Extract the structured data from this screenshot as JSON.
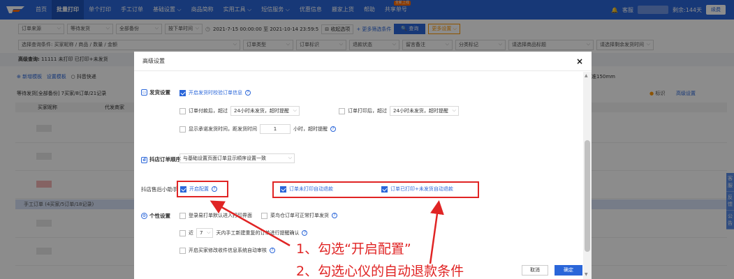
{
  "topbar": {
    "nav": [
      "首页",
      "批量打印",
      "单个打印",
      "手工订单",
      "基础设置 ⌵",
      "商品简称",
      "实用工具 ⌵",
      "短信服务 ⌵",
      "优惠信息",
      "搬家上货",
      "帮助",
      "共享单号"
    ],
    "active_index": 1,
    "badge": "全新上线",
    "service": "客服",
    "remaining": "剩余:144天",
    "renew": "续费"
  },
  "filters": {
    "row1": [
      "订单来源",
      "等待发货",
      "全部备份",
      "按下单时间"
    ],
    "date_range": "2021-7-15 00:00:00 至 2021-10-14 23:59:5",
    "collapse": "收起选项",
    "more_filters": "+ 更多筛选条件",
    "query": "查询",
    "more_settings": "更多设置",
    "row2": [
      "选择查询条件: 买家昵称 / 商品 / 数量 / 金额",
      "订单类型",
      "订单标识",
      "退款状态",
      "留言备注",
      "分类标记",
      "请选择商品标题",
      "请选择剩余发货时间"
    ],
    "quick_label": "高级查询:",
    "quick_items": "11111   未打印   已打印+未发货"
  },
  "background": {
    "new_template": "新增模板",
    "template_settings": "设置模板",
    "waybill": "抖音快递",
    "paper": "标准150mm",
    "status_line": "等待发货[全部备份]  7买家/8订单/21记录",
    "col_buyer": "买家昵称",
    "col_seller": "代发商家",
    "flag": "标识",
    "adv_settings": "高级设置",
    "group": "手工订单 (4买家/5订单/18记录)",
    "side_tabs": [
      "客服",
      "反馈",
      "公告"
    ]
  },
  "modal": {
    "title": "高级设置",
    "close": "×",
    "ship": {
      "label": "发货设置",
      "verify": "开启发货时校验订单信息",
      "pay_prefix": "订单付款后，超过",
      "pay_select": "24小时未发货，超时提醒",
      "print_prefix": "订单打印后，超过",
      "print_select": "24小时未发货，超时提醒",
      "promise_prefix": "显示承诺发货时间，距发货时间",
      "promise_value": "1",
      "promise_suffix": "小时，超时提醒"
    },
    "sort": {
      "label": "抖店订单顺序",
      "select": "与基础设置页面订单显示顺序设置一致"
    },
    "after_sale": {
      "label": "抖店售后小助手",
      "enable": "开启配置",
      "refund1": "订单未打印自动退款",
      "refund2": "订单已打印+未发货自动退款"
    },
    "personal": {
      "label": "个性设置",
      "opt1": "登录易打单默认进入打印界面",
      "opt2": "菜鸟仓订单可正常打单发货",
      "opt3_prefix": "近",
      "opt3_value": "7",
      "opt3_suffix": "天内手工新建重复的订单进行提醒确认",
      "opt4": "开启买家修改收件信息系统自动审核"
    },
    "cancel": "取消",
    "ok": "确定"
  },
  "annotations": {
    "step1": "1、勾选“开启配置”",
    "step2": "2、勾选心仪的自动退款条件"
  },
  "colors": {
    "brand": "#2a66d9",
    "highlight": "#e02424"
  }
}
